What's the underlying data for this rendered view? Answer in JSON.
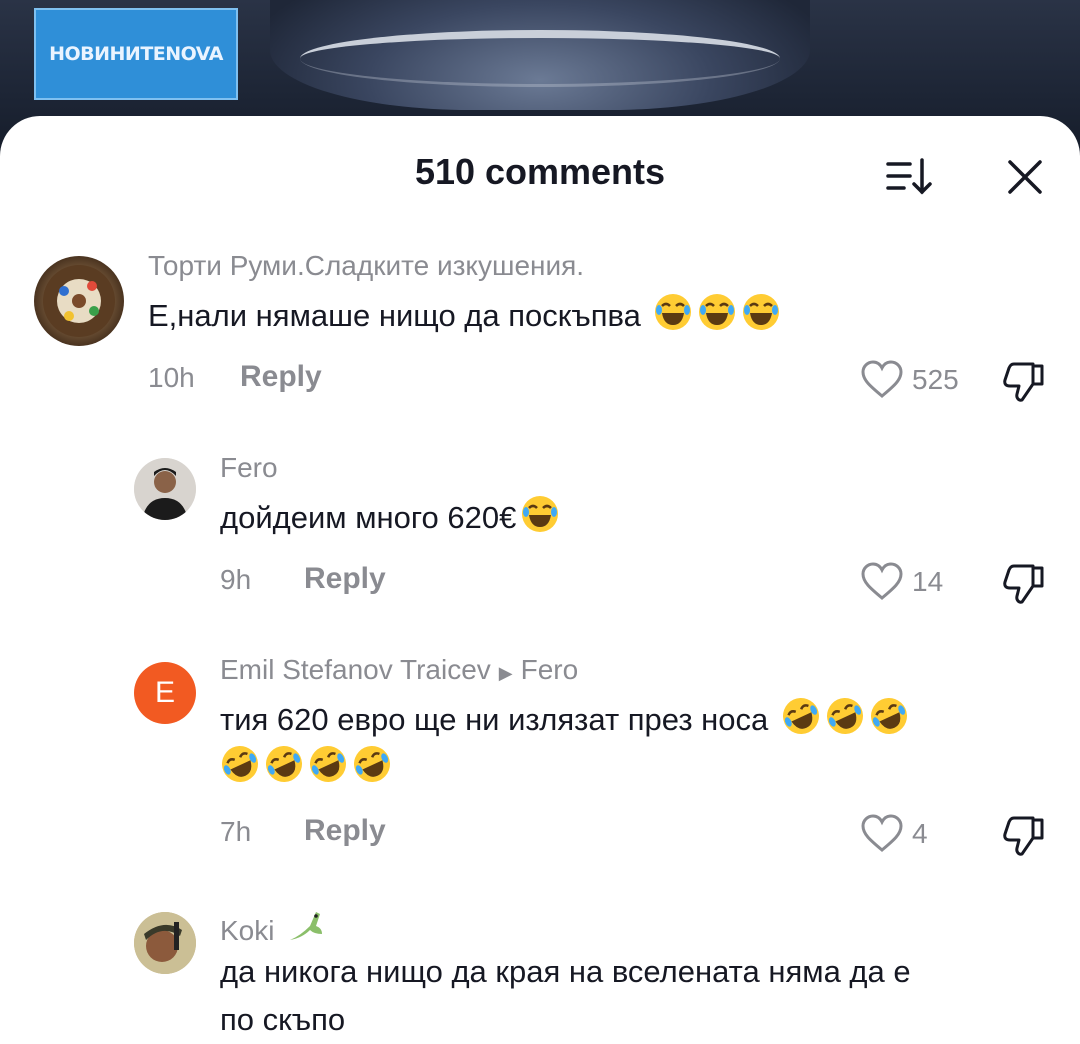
{
  "video": {
    "logo_text": "НОВИНИТЕNOVA"
  },
  "header": {
    "title": "510 comments"
  },
  "icons": {
    "sort": "sort-icon",
    "close": "close-icon",
    "like": "heart-icon",
    "dislike": "thumbs-down-icon"
  },
  "colors": {
    "avatar_e": "#f25a22",
    "text": "#161823",
    "muted": "#8a8b91"
  },
  "comments": [
    {
      "username": "Торти Руми.Сладките изкушения.",
      "text": "Е,нали нямаше нищо да поскъпва",
      "emojis": [
        "laugh",
        "laugh",
        "laugh"
      ],
      "time": "10h",
      "reply_label": "Reply",
      "likes": "525"
    },
    {
      "username": "Fero",
      "text": "дойдеим много 620€",
      "emojis": [
        "laugh"
      ],
      "time": "9h",
      "reply_label": "Reply",
      "likes": "14"
    },
    {
      "username": "Emil Stefanov Traicev",
      "reply_to": "Fero",
      "avatar_letter": "E",
      "text_line1": "тия 620 евро ще ни излязат през носа",
      "emojis_line1": [
        "rofl",
        "rofl",
        "rofl"
      ],
      "emojis_line2": [
        "rofl",
        "rofl",
        "rofl",
        "rofl"
      ],
      "time": "7h",
      "reply_label": "Reply",
      "likes": "4"
    },
    {
      "username": "Koki",
      "text_line1": "да никога нищо да края на вселената няма да е",
      "text_line2": "по скъпо"
    }
  ]
}
